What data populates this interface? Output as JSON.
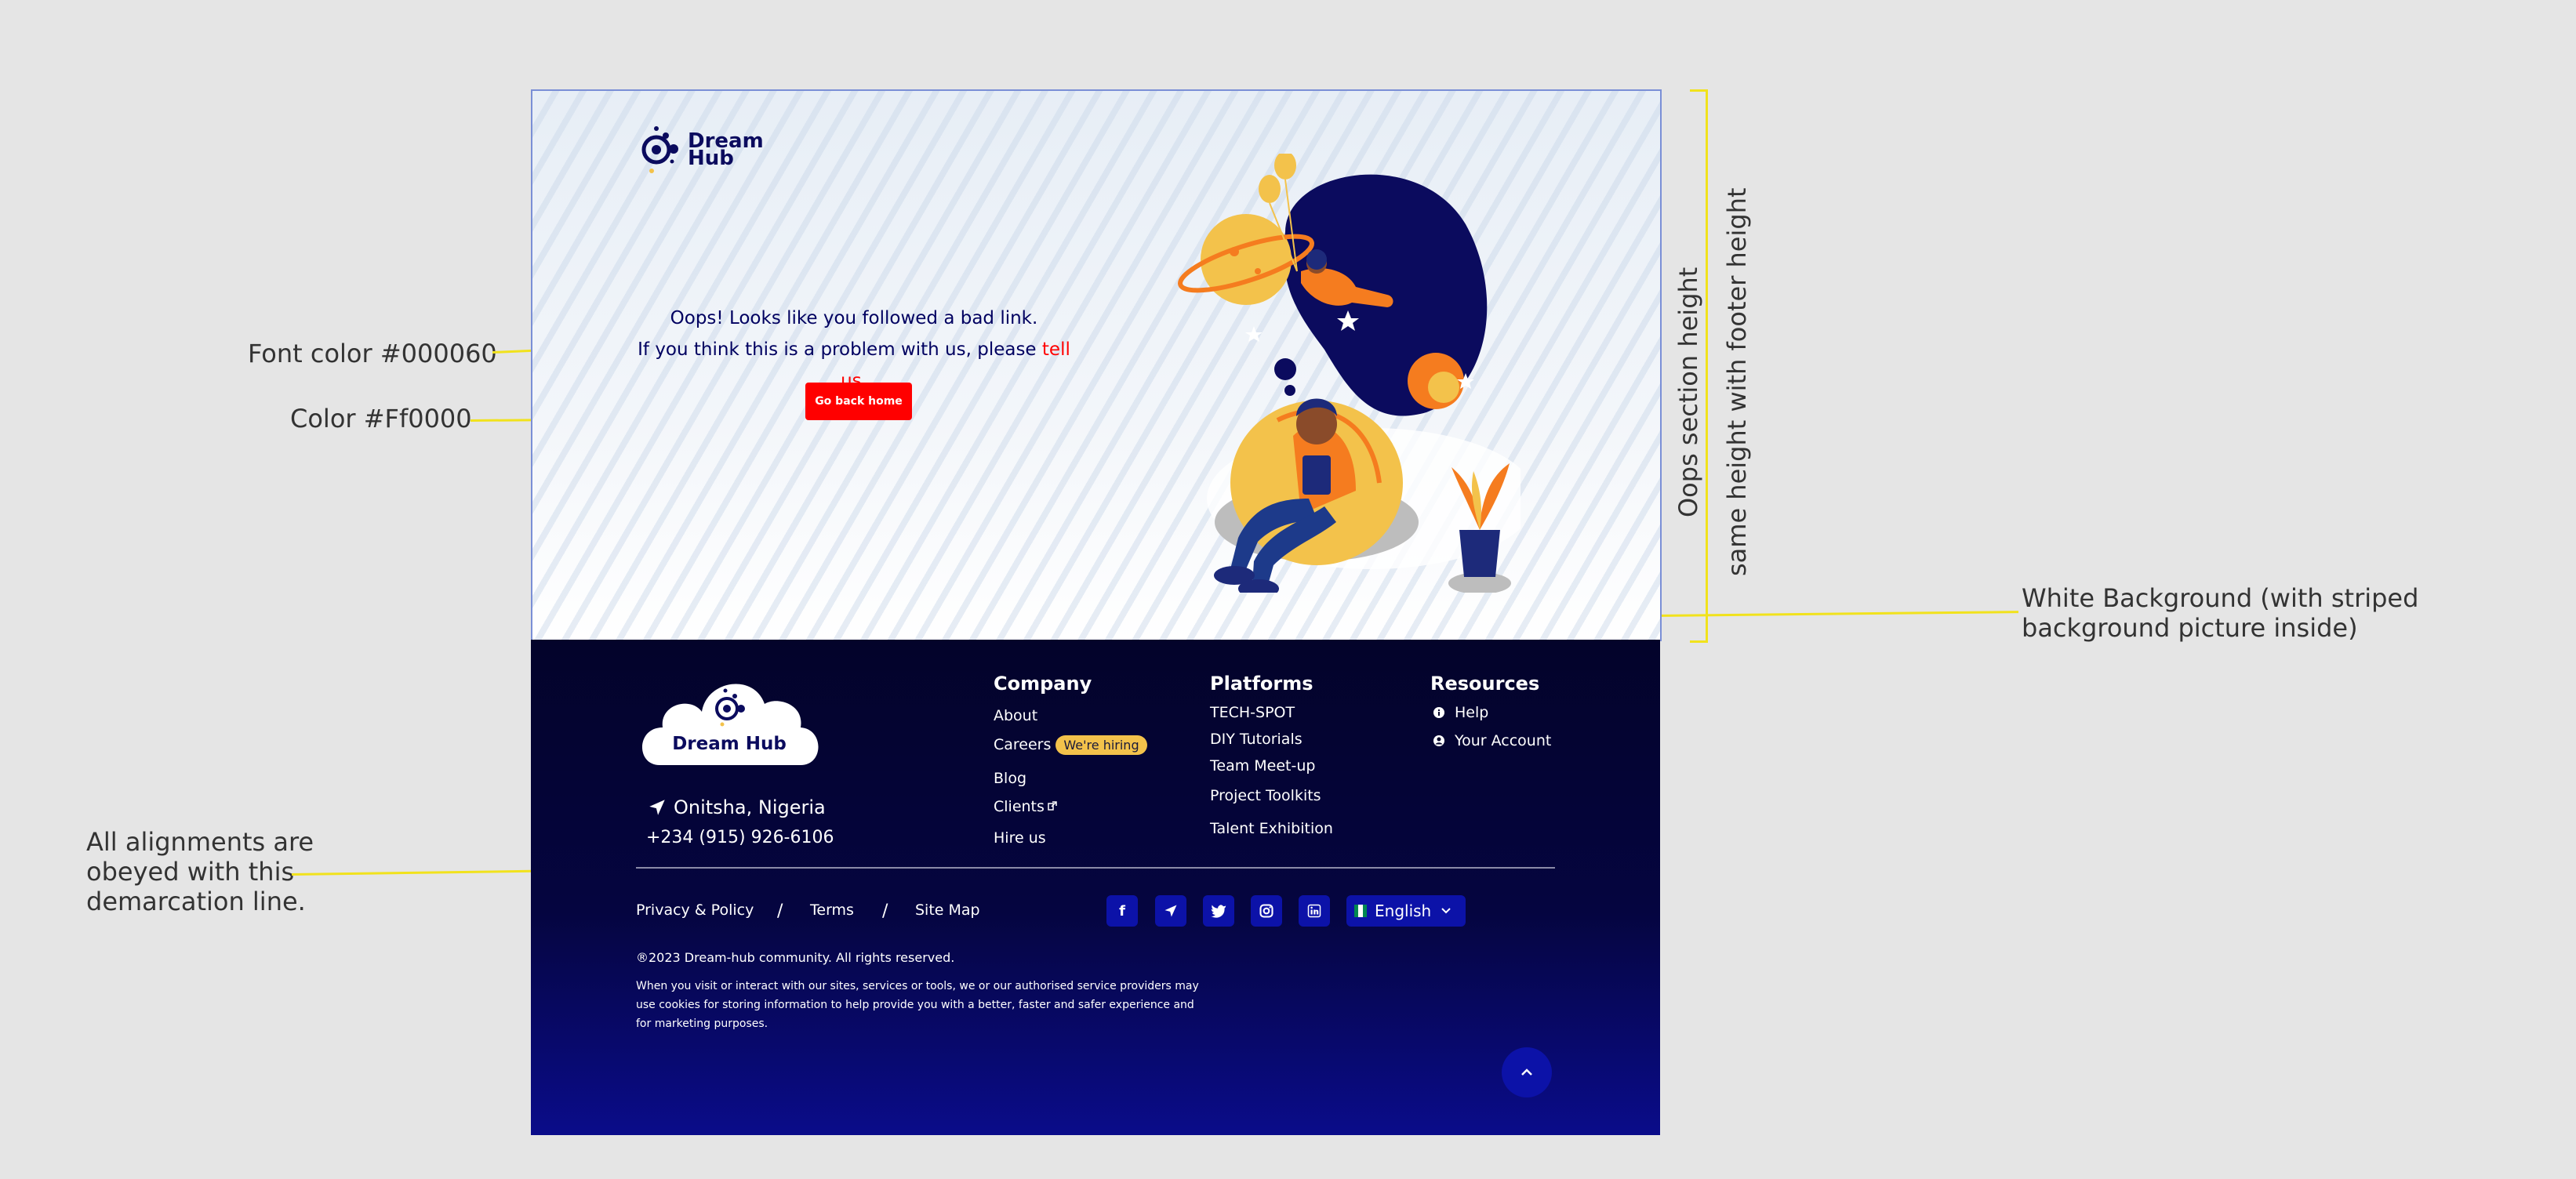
{
  "annotations": {
    "font_color": "Font color #000060",
    "color_red": "Color #Ff0000",
    "alignment": "All alignments are obeyed with this demarcation line.",
    "white_bg": "White Background (with striped background picture inside)",
    "oops_height": "Oops section height",
    "same_height": "same height with footer height"
  },
  "colors": {
    "font": "#000060",
    "accent_red": "#ff0000",
    "footer_dark": "#03032a",
    "footer_blue": "#0a0c8a",
    "badge": "#f3c24b"
  },
  "brand": {
    "line1": "Dream",
    "line2": "Hub",
    "cloud_name": "Dream Hub"
  },
  "oops": {
    "line1": "Oops! Looks like you followed a bad link.",
    "line2_prefix": "If you think this is a problem with us, please ",
    "line2_link": "tell us.",
    "button": "Go back home"
  },
  "footer": {
    "location": "Onitsha, Nigeria",
    "phone": "+234 (915) 926-6106",
    "company": {
      "title": "Company",
      "items": [
        "About",
        "Careers",
        "Blog",
        "Clients",
        "Hire us"
      ],
      "careers_badge": "We're hiring"
    },
    "platforms": {
      "title": "Platforms",
      "items": [
        "TECH-SPOT",
        "DIY Tutorials",
        "Team Meet-up",
        "Project Toolkits",
        "Talent Exhibition"
      ]
    },
    "resources": {
      "title": "Resources",
      "items": [
        "Help",
        "Your Account"
      ]
    },
    "bottom_links": [
      "Privacy & Policy",
      "Terms",
      "Site Map"
    ],
    "separator": "/",
    "social_icons": [
      "facebook-icon",
      "telegram-icon",
      "twitter-icon",
      "instagram-icon",
      "linkedin-icon"
    ],
    "language": "English",
    "copyright": "®2023 Dream-hub community. All rights reserved.",
    "legal": "When you visit or interact with our sites, services or tools, we or our authorised service providers may use cookies for storing information to help provide you with a better, faster and safer experience and for marketing purposes."
  }
}
